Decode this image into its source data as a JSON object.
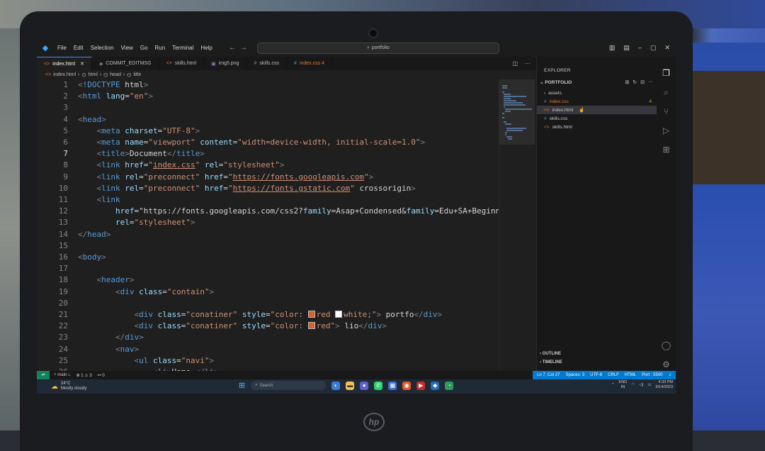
{
  "titlebar": {
    "menu": [
      "File",
      "Edit",
      "Selection",
      "View",
      "Go",
      "Run",
      "Terminal",
      "Help"
    ],
    "search": "portfolio"
  },
  "tabs": [
    {
      "label": "index.html",
      "icon": "html-file-icon",
      "active": true
    },
    {
      "label": "COMMIT_EDITMSG",
      "icon": "git-icon"
    },
    {
      "label": "skills.html",
      "icon": "html-file-icon"
    },
    {
      "label": "img5.png",
      "icon": "image-file-icon"
    },
    {
      "label": "skills.css",
      "icon": "css-file-icon"
    },
    {
      "label": "index.css 4",
      "icon": "css-file-icon"
    }
  ],
  "breadcrumb": [
    "index.html",
    "html",
    "head",
    "title"
  ],
  "code_lines": [
    "<!DOCTYPE html>",
    "<html lang=\"en\">",
    "",
    "<head>",
    "    <meta charset=\"UTF-8\">",
    "    <meta name=\"viewport\" content=\"width=device-width, initial-scale=1.0\">",
    "    <title>Document</title>",
    "    <link href=\"index.css\" rel=\"stylesheet\">",
    "    <link rel=\"preconnect\" href=\"https://fonts.googleapis.com\">",
    "    <link rel=\"preconnect\" href=\"https://fonts.gstatic.com\" crossorigin>",
    "    <link",
    "        href=\"https://fonts.googleapis.com/css2?family=Asap+Condensed&family=Edu+SA+Beginner",
    "        rel=\"stylesheet\">",
    "</head>",
    "",
    "<body>",
    "",
    "    <header>",
    "        <div class=\"contain\">",
    "",
    "            <div class=\"conatiner\" style=\"color: red white;\"> portfo</div>",
    "            <div class=\"conatiner\" style=\"color: red\"> lio</div>",
    "        </div>",
    "        <nav>",
    "            <ul class=\"navi\">",
    "                <li>Home </li>"
  ],
  "explorer": {
    "title": "EXPLORER",
    "folder": "PORTFOLIO",
    "items": [
      {
        "label": "assets",
        "type": "folder"
      },
      {
        "label": "index.css",
        "type": "css",
        "badge": "4"
      },
      {
        "label": "index.html",
        "type": "html",
        "selected": true
      },
      {
        "label": "skills.css",
        "type": "css"
      },
      {
        "label": "skills.html",
        "type": "html"
      }
    ],
    "outline": "OUTLINE",
    "timeline": "TIMELINE"
  },
  "statusbar": {
    "branch": "main",
    "problems": "⊗ 1 ⚠ 3",
    "ports": "0",
    "position": "Ln 7, Col 27",
    "spaces": "Spaces: 3",
    "encoding": "UTF-8",
    "eol": "CRLF",
    "language": "HTML",
    "port": "Port : 5500"
  },
  "taskbar": {
    "temp": "24°C",
    "weather": "Mostly cloudy",
    "search": "Search",
    "lang": "ENG",
    "region": "IN",
    "time": "4:33 PM",
    "date": "9/14/2023"
  },
  "colors": {
    "accent": "#007acc",
    "editor_bg": "#1f1f1f"
  }
}
